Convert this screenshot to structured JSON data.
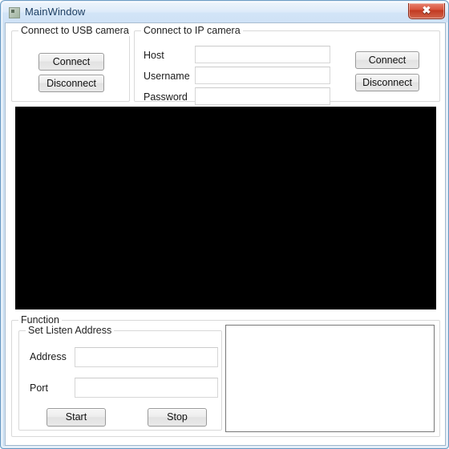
{
  "window": {
    "title": "MainWindow",
    "icon": "app-window-icon",
    "close_label": "✖",
    "accent_titlebar": "#d2e4f7",
    "close_button_color": "#c23a22"
  },
  "usb_group": {
    "title": "Connect to USB camera",
    "connect_label": "Connect",
    "disconnect_label": "Disconnect"
  },
  "ip_group": {
    "title": "Connect to IP camera",
    "host_label": "Host",
    "username_label": "Username",
    "password_label": "Password",
    "host_value": "",
    "username_value": "",
    "password_value": "",
    "host_placeholder": "",
    "username_placeholder": "",
    "password_placeholder": "",
    "connect_label": "Connect",
    "disconnect_label": "Disconnect"
  },
  "video": {
    "name": "camera-preview",
    "background": "#000000",
    "content": ""
  },
  "function_group": {
    "title": "Function",
    "listen_group": {
      "title": "Set Listen Address",
      "address_label": "Address",
      "port_label": "Port",
      "address_value": "",
      "port_value": "",
      "address_placeholder": "",
      "port_placeholder": "",
      "start_label": "Start",
      "stop_label": "Stop"
    },
    "log": {
      "value": ""
    }
  }
}
